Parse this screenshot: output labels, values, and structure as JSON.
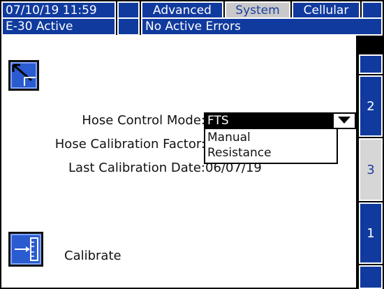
{
  "header": {
    "datetime": "07/10/19 11:59",
    "status": "E-30 Active",
    "errors": "No Active Errors",
    "tabs": [
      {
        "label": "Advanced"
      },
      {
        "label": "System"
      },
      {
        "label": "Cellular"
      }
    ]
  },
  "form": {
    "hose_control_mode_label": "Hose Control Mode:",
    "hose_control_mode_value": "FTS",
    "options": [
      "Manual",
      "Resistance"
    ],
    "hose_calibration_factor_label": "Hose Calibration Factor:",
    "last_calibration_date_label": "Last Calibration Date:",
    "last_calibration_date_value": "06/07/19"
  },
  "calibrate": {
    "label": "Calibrate"
  },
  "side_tabs": [
    "2",
    "3",
    "1"
  ],
  "colors": {
    "accent": "#103a9e",
    "selected_tab": "#c9c9c9",
    "panel": "#ffffff"
  }
}
